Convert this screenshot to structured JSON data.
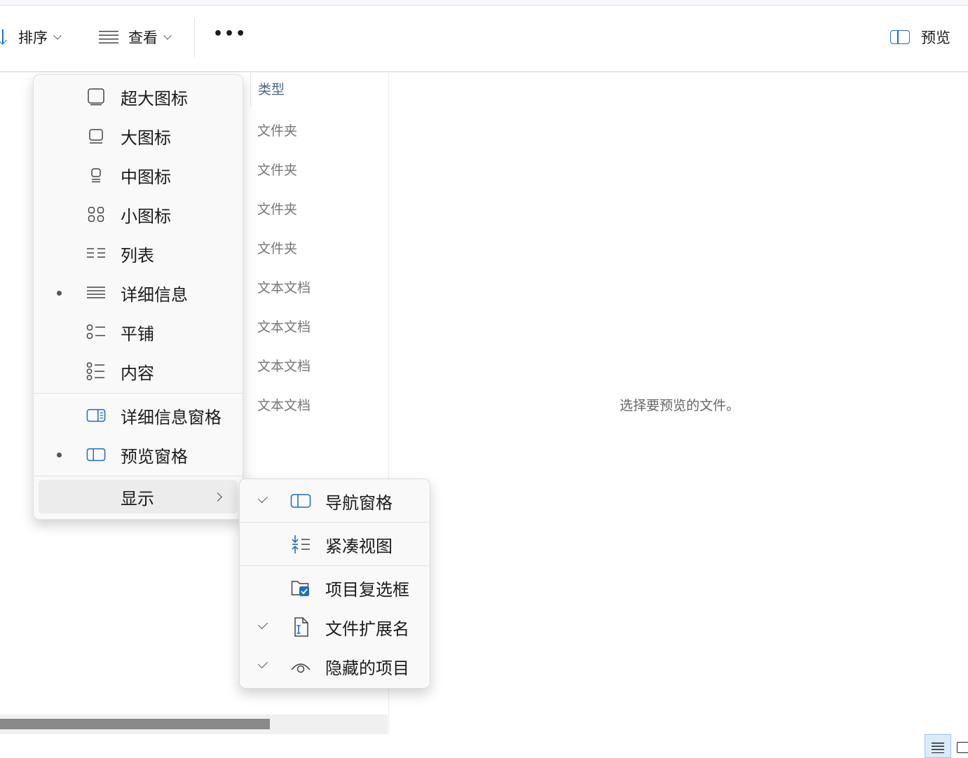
{
  "toolbar": {
    "sort_label": "排序",
    "view_label": "查看",
    "more_label": "•••",
    "preview_label": "预览"
  },
  "type_column": {
    "header": "类型",
    "rows": [
      "文件夹",
      "文件夹",
      "文件夹",
      "文件夹",
      "文本文档",
      "文本文档",
      "文本文档",
      "文本文档"
    ]
  },
  "preview": {
    "message": "选择要预览的文件。"
  },
  "view_menu": {
    "items": [
      {
        "label": "超大图标",
        "icon": "extra-large-icons-icon",
        "selected": false
      },
      {
        "label": "大图标",
        "icon": "large-icons-icon",
        "selected": false
      },
      {
        "label": "中图标",
        "icon": "medium-icons-icon",
        "selected": false
      },
      {
        "label": "小图标",
        "icon": "small-icons-icon",
        "selected": false
      },
      {
        "label": "列表",
        "icon": "list-icon",
        "selected": false
      },
      {
        "label": "详细信息",
        "icon": "details-icon",
        "selected": true
      },
      {
        "label": "平铺",
        "icon": "tiles-icon",
        "selected": false
      },
      {
        "label": "内容",
        "icon": "content-icon",
        "selected": false
      }
    ],
    "panes": [
      {
        "label": "详细信息窗格",
        "icon": "details-pane-icon",
        "selected": false
      },
      {
        "label": "预览窗格",
        "icon": "preview-pane-icon",
        "selected": true
      }
    ],
    "show_label": "显示"
  },
  "show_submenu": {
    "items": [
      {
        "label": "导航窗格",
        "icon": "navigation-pane-icon",
        "checked": true
      },
      {
        "label": "紧凑视图",
        "icon": "compact-view-icon",
        "checked": false
      },
      {
        "label": "项目复选框",
        "icon": "item-checkbox-icon",
        "checked": false
      },
      {
        "label": "文件扩展名",
        "icon": "file-extension-icon",
        "checked": true
      },
      {
        "label": "隐藏的项目",
        "icon": "hidden-items-icon",
        "checked": true
      }
    ]
  },
  "colors": {
    "accent": "#1f6fbf",
    "menu_bg": "#f9f9f9"
  }
}
